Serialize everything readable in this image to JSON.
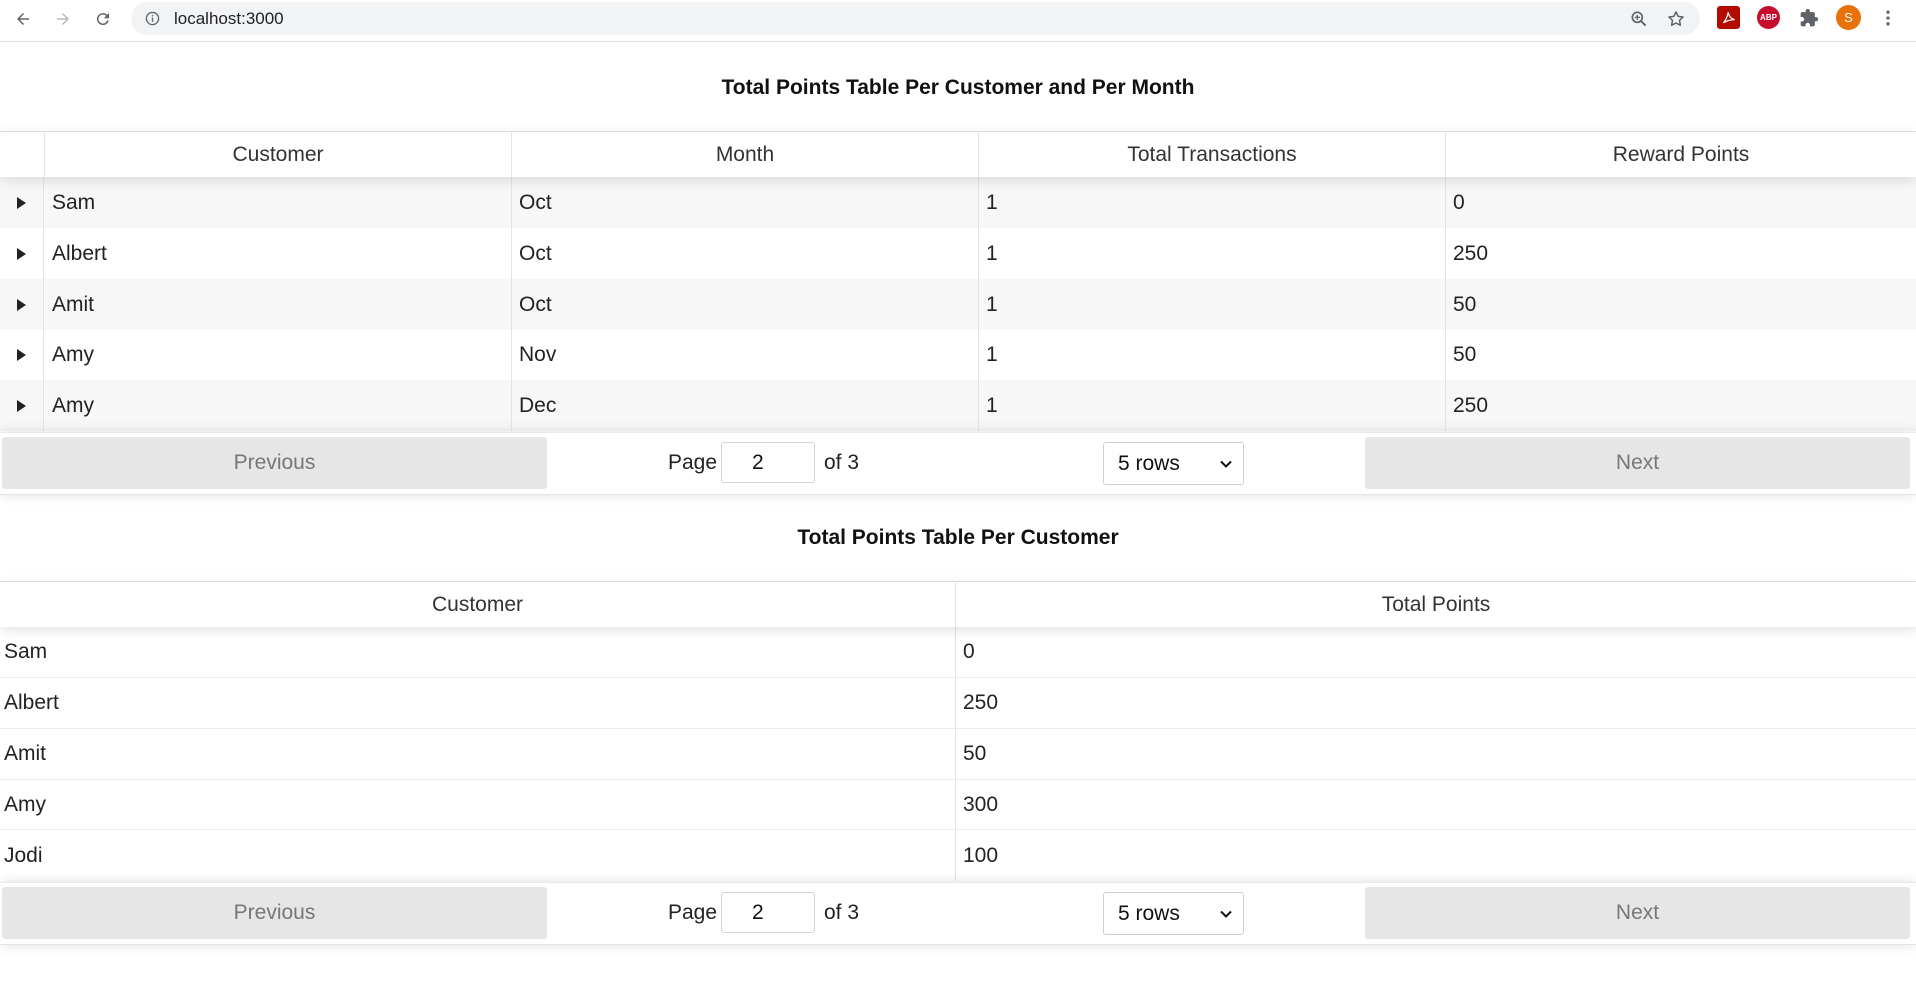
{
  "browser": {
    "url": "localhost:3000",
    "avatar_letter": "S",
    "abp_label": "ABP"
  },
  "table1": {
    "title": "Total Points Table Per Customer and Per Month",
    "columns": [
      "Customer",
      "Month",
      "Total Transactions",
      "Reward Points"
    ],
    "rows": [
      [
        "Sam",
        "Oct",
        "1",
        "0"
      ],
      [
        "Albert",
        "Oct",
        "1",
        "250"
      ],
      [
        "Amit",
        "Oct",
        "1",
        "50"
      ],
      [
        "Amy",
        "Nov",
        "1",
        "50"
      ],
      [
        "Amy",
        "Dec",
        "1",
        "250"
      ]
    ],
    "pagination": {
      "previous_label": "Previous",
      "next_label": "Next",
      "page_label": "Page",
      "page_value": "2",
      "of_label": "of 3",
      "rows_option": "5 rows"
    }
  },
  "table2": {
    "title": "Total Points Table Per Customer",
    "columns": [
      "Customer",
      "Total Points"
    ],
    "rows": [
      [
        "Sam",
        "0"
      ],
      [
        "Albert",
        "250"
      ],
      [
        "Amit",
        "50"
      ],
      [
        "Amy",
        "300"
      ],
      [
        "Jodi",
        "100"
      ]
    ],
    "pagination": {
      "previous_label": "Previous",
      "next_label": "Next",
      "page_label": "Page",
      "page_value": "2",
      "of_label": "of 3",
      "rows_option": "5 rows"
    }
  }
}
